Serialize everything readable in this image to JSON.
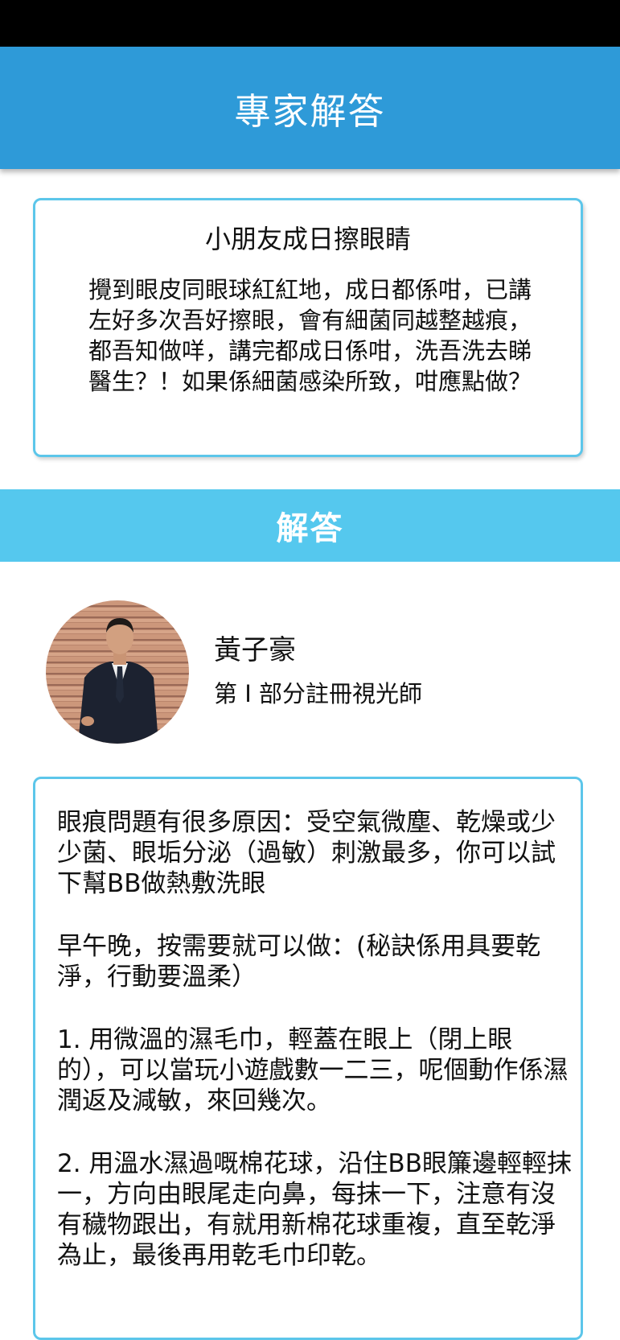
{
  "header": {
    "title": "專家解答"
  },
  "question": {
    "title": "小朋友成日擦眼睛",
    "body": "攪到眼皮同眼球紅紅地，成日都係咁，已講左好多次吾好擦眼，會有細菌同越整越痕，都吾知做咩，講完都成日係咁，洗吾洗去睇醫生？！如果係細菌感染所致，咁應點做？"
  },
  "answer_section": {
    "heading": "解答"
  },
  "expert": {
    "name": "黃子豪",
    "title": "第 I 部分註冊視光師",
    "avatar_icon": "expert-photo"
  },
  "answer": {
    "paragraphs": [
      "眼痕問題有很多原因：受空氣微塵、乾燥或少少菌、眼垢分泌（過敏）刺激最多，你可以試下幫BB做熱敷洗眼",
      "早午晚，按需要就可以做：(秘訣係用具要乾淨，行動要溫柔）",
      "1. 用微溫的濕毛巾，輕蓋在眼上（閉上眼的），可以當玩小遊戲數一二三，呢個動作係濕潤返及減敏，來回幾次。",
      "2. 用溫水濕過嘅棉花球，沿住BB眼簾邊輕輕抹一，方向由眼尾走向鼻，每抹一下，注意有沒有穢物跟出，有就用新棉花球重複，直至乾淨為止，最後再用乾毛巾印乾。"
    ]
  },
  "colors": {
    "header_blue": "#2e9ad8",
    "banner_blue": "#55c8ee",
    "card_border": "#5cc6ea"
  }
}
